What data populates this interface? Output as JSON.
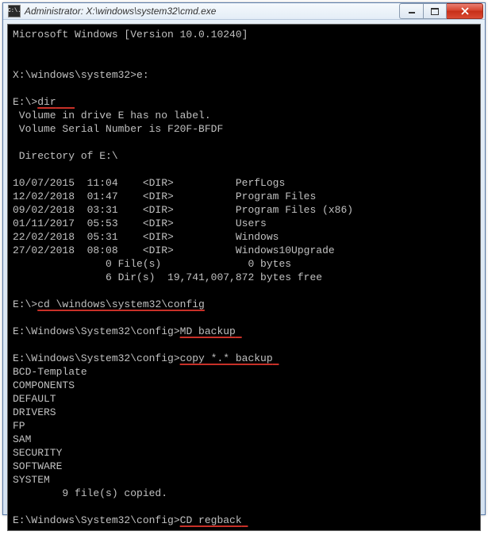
{
  "titlebar": {
    "icon_label": "C:\\.",
    "title": "Administrator: X:\\windows\\system32\\cmd.exe"
  },
  "terminal": {
    "header": "Microsoft Windows [Version 10.0.10240]",
    "prompt1": "X:\\windows\\system32>",
    "cmd1": "e:",
    "prompt2": "E:\\>",
    "cmd2": "dir",
    "vol_label": " Volume in drive E has no label.",
    "vol_serial": " Volume Serial Number is F20F-BFDF",
    "dir_of": " Directory of E:\\",
    "rows": [
      "10/07/2015  11:04    <DIR>          PerfLogs",
      "12/02/2018  01:47    <DIR>          Program Files",
      "09/02/2018  03:31    <DIR>          Program Files (x86)",
      "01/11/2017  05:53    <DIR>          Users",
      "22/02/2018  05:31    <DIR>          Windows",
      "27/02/2018  08:08    <DIR>          Windows10Upgrade"
    ],
    "summary1": "               0 File(s)              0 bytes",
    "summary2": "               6 Dir(s)  19,741,007,872 bytes free",
    "prompt3": "E:\\>",
    "cmd3": "cd \\windows\\system32\\config",
    "prompt4": "E:\\Windows\\System32\\config>",
    "cmd4": "MD backup",
    "prompt5": "E:\\Windows\\System32\\config>",
    "cmd5": "copy *.* backup",
    "files": [
      "BCD-Template",
      "COMPONENTS",
      "DEFAULT",
      "DRIVERS",
      "FP",
      "SAM",
      "SECURITY",
      "SOFTWARE",
      "SYSTEM"
    ],
    "copied": "        9 file(s) copied.",
    "prompt6": "E:\\Windows\\System32\\config>",
    "cmd6": "CD regback"
  }
}
